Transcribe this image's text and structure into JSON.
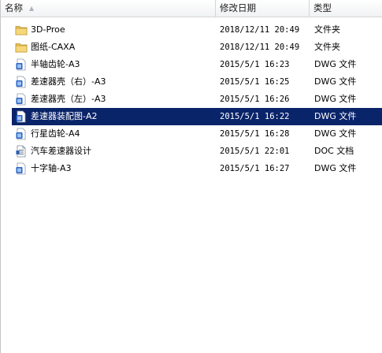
{
  "columns": {
    "name": "名称",
    "date": "修改日期",
    "type": "类型"
  },
  "sort_indicator_icon": "sort-ascending-icon",
  "selected_color": "#0a246a",
  "files": [
    {
      "name": "3D-Proe",
      "date": "2018/12/11 20:49",
      "type": "文件夹",
      "icon": "folder-icon"
    },
    {
      "name": "图纸-CAXA",
      "date": "2018/12/11 20:49",
      "type": "文件夹",
      "icon": "folder-icon"
    },
    {
      "name": "半轴齿轮-A3",
      "date": "2015/5/1 16:23",
      "type": "DWG 文件",
      "icon": "dwg-file-icon"
    },
    {
      "name": "差速器壳（右）-A3",
      "date": "2015/5/1 16:25",
      "type": "DWG 文件",
      "icon": "dwg-file-icon"
    },
    {
      "name": "差速器壳（左）-A3",
      "date": "2015/5/1 16:26",
      "type": "DWG 文件",
      "icon": "dwg-file-icon"
    },
    {
      "name": "差速器装配图-A2",
      "date": "2015/5/1 16:22",
      "type": "DWG 文件",
      "icon": "dwg-file-icon",
      "selected": true
    },
    {
      "name": "行星齿轮-A4",
      "date": "2015/5/1 16:28",
      "type": "DWG 文件",
      "icon": "dwg-file-icon"
    },
    {
      "name": "汽车差速器设计",
      "date": "2015/5/1 22:01",
      "type": "DOC 文档",
      "icon": "doc-file-icon"
    },
    {
      "name": "十字轴-A3",
      "date": "2015/5/1 16:27",
      "type": "DWG 文件",
      "icon": "dwg-file-icon"
    }
  ]
}
